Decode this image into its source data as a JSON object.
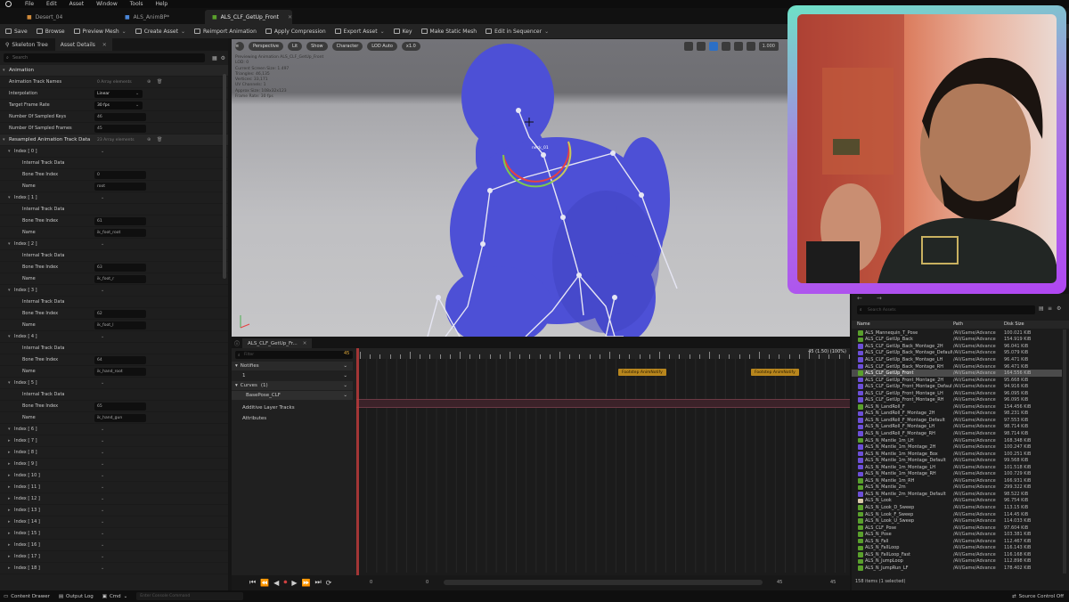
{
  "menu": [
    "File",
    "Edit",
    "Asset",
    "Window",
    "Tools",
    "Help"
  ],
  "doc_tabs": [
    {
      "label": "Desert_04",
      "active": false
    },
    {
      "label": "ALS_AnimBP*",
      "active": false
    },
    {
      "label": "ALS_CLF_GetUp_Front",
      "active": true
    }
  ],
  "toolbar": [
    {
      "label": "Save",
      "icon": "save-icon"
    },
    {
      "label": "Browse",
      "icon": "browse-icon"
    },
    {
      "label": "Preview Mesh",
      "icon": "preview-mesh-icon",
      "dropdown": true
    },
    {
      "label": "Create Asset",
      "icon": "create-asset-icon",
      "dropdown": true
    },
    {
      "label": "Reimport Animation",
      "icon": "reimport-icon"
    },
    {
      "label": "Apply Compression",
      "icon": "compression-icon"
    },
    {
      "label": "Export Asset",
      "icon": "export-icon",
      "dropdown": true
    },
    {
      "label": "Key",
      "icon": "key-icon"
    },
    {
      "label": "Make Static Mesh",
      "icon": "static-mesh-icon"
    },
    {
      "label": "Edit in Sequencer",
      "icon": "sequencer-icon",
      "dropdown": true
    }
  ],
  "left_panel": {
    "tabs": [
      "Skeleton Tree",
      "Asset Details"
    ],
    "search_placeholder": "Search",
    "rows": [
      {
        "type": "cat",
        "label": "Animation",
        "indent": 0
      },
      {
        "type": "prop",
        "label": "Animation Track Names",
        "indent": 1,
        "value": "0 Array elements",
        "style": "dim"
      },
      {
        "type": "prop",
        "label": "Interpolation",
        "indent": 1,
        "value": "Linear",
        "style": "dd"
      },
      {
        "type": "prop",
        "label": "Target Frame Rate",
        "indent": 1,
        "value": "30 fps",
        "style": "dd"
      },
      {
        "type": "prop",
        "label": "Number Of Sampled Keys",
        "indent": 1,
        "value": "46",
        "style": "box"
      },
      {
        "type": "prop",
        "label": "Number Of Sampled Frames",
        "indent": 1,
        "value": "45",
        "style": "box"
      },
      {
        "type": "cat",
        "label": "Resampled Animation Track Data",
        "indent": 0,
        "value": "23 Array elements",
        "style": "dim"
      },
      {
        "type": "idx",
        "label": "Index [ 0 ]",
        "indent": 1
      },
      {
        "type": "prop",
        "label": "Internal Track Data",
        "indent": 2
      },
      {
        "type": "prop",
        "label": "Bone Tree Index",
        "indent": 2,
        "value": "0",
        "style": "box"
      },
      {
        "type": "prop",
        "label": "Name",
        "indent": 2,
        "value": "root",
        "style": "box"
      },
      {
        "type": "idx",
        "label": "Index [ 1 ]",
        "indent": 1
      },
      {
        "type": "prop",
        "label": "Internal Track Data",
        "indent": 2
      },
      {
        "type": "prop",
        "label": "Bone Tree Index",
        "indent": 2,
        "value": "61",
        "style": "box"
      },
      {
        "type": "prop",
        "label": "Name",
        "indent": 2,
        "value": "ik_foot_root",
        "style": "box"
      },
      {
        "type": "idx",
        "label": "Index [ 2 ]",
        "indent": 1
      },
      {
        "type": "prop",
        "label": "Internal Track Data",
        "indent": 2
      },
      {
        "type": "prop",
        "label": "Bone Tree Index",
        "indent": 2,
        "value": "63",
        "style": "box"
      },
      {
        "type": "prop",
        "label": "Name",
        "indent": 2,
        "value": "ik_foot_r",
        "style": "box"
      },
      {
        "type": "idx",
        "label": "Index [ 3 ]",
        "indent": 1
      },
      {
        "type": "prop",
        "label": "Internal Track Data",
        "indent": 2
      },
      {
        "type": "prop",
        "label": "Bone Tree Index",
        "indent": 2,
        "value": "62",
        "style": "box"
      },
      {
        "type": "prop",
        "label": "Name",
        "indent": 2,
        "value": "ik_foot_l",
        "style": "box"
      },
      {
        "type": "idx",
        "label": "Index [ 4 ]",
        "indent": 1
      },
      {
        "type": "prop",
        "label": "Internal Track Data",
        "indent": 2
      },
      {
        "type": "prop",
        "label": "Bone Tree Index",
        "indent": 2,
        "value": "64",
        "style": "box"
      },
      {
        "type": "prop",
        "label": "Name",
        "indent": 2,
        "value": "ik_hand_root",
        "style": "box"
      },
      {
        "type": "idx",
        "label": "Index [ 5 ]",
        "indent": 1
      },
      {
        "type": "prop",
        "label": "Internal Track Data",
        "indent": 2
      },
      {
        "type": "prop",
        "label": "Bone Tree Index",
        "indent": 2,
        "value": "65",
        "style": "box"
      },
      {
        "type": "prop",
        "label": "Name",
        "indent": 2,
        "value": "ik_hand_gun",
        "style": "box"
      },
      {
        "type": "idx",
        "label": "Index [ 6 ]",
        "indent": 1
      },
      {
        "type": "idx",
        "label": "Index [ 7 ]",
        "indent": 1
      },
      {
        "type": "idx",
        "label": "Index [ 8 ]",
        "indent": 1
      },
      {
        "type": "idx",
        "label": "Index [ 9 ]",
        "indent": 1
      },
      {
        "type": "idx",
        "label": "Index [ 10 ]",
        "indent": 1
      },
      {
        "type": "idx",
        "label": "Index [ 11 ]",
        "indent": 1
      },
      {
        "type": "idx",
        "label": "Index [ 12 ]",
        "indent": 1
      },
      {
        "type": "idx",
        "label": "Index [ 13 ]",
        "indent": 1
      },
      {
        "type": "idx",
        "label": "Index [ 14 ]",
        "indent": 1
      },
      {
        "type": "idx",
        "label": "Index [ 15 ]",
        "indent": 1
      },
      {
        "type": "idx",
        "label": "Index [ 16 ]",
        "indent": 1
      },
      {
        "type": "idx",
        "label": "Index [ 17 ]",
        "indent": 1
      },
      {
        "type": "idx",
        "label": "Index [ 18 ]",
        "indent": 1
      }
    ]
  },
  "viewport": {
    "buttons": [
      "Perspective",
      "Lit",
      "Show",
      "Character",
      "LOD Auto",
      "x1.0"
    ],
    "fov": "1.000",
    "info_lines": [
      "Previewing Animation ALS_CLF_GetUp_Front",
      "LOD: 0",
      "Current Screen Size: 1.497",
      "Triangles: 46,135",
      "Vertices: 33,171",
      "UV Channels: 1",
      "Approx Size: 108x32x123",
      "Frame Rate: 30 fps"
    ],
    "bone_label": "neck_01"
  },
  "sequencer": {
    "tab": "ALS_CLF_GetUp_Fr...",
    "filter_placeholder": "Filter",
    "frame_counter": "45",
    "timecode": "45 (1.50) (100%)",
    "tracks": [
      {
        "label": "Notifies",
        "kind": "header"
      },
      {
        "label": "1",
        "kind": "sub"
      },
      {
        "label": "Curves",
        "count": "(1)",
        "kind": "header"
      },
      {
        "label": "BasePose_CLF",
        "kind": "curve"
      },
      {
        "label": "Additive Layer Tracks",
        "kind": "plain"
      },
      {
        "label": "Attributes",
        "kind": "plain"
      }
    ],
    "notifies": [
      "Footstep AnimNotify",
      "Footstep AnimNotify"
    ],
    "range_left": "0",
    "range_mid": "0",
    "range_right1": "45",
    "range_right2": "45"
  },
  "assets": {
    "search_placeholder": "Search Assets",
    "columns": [
      "Name",
      "Path",
      "Disk Size"
    ],
    "items": [
      {
        "name": "ALS_Mannequin_T_Pose",
        "path": "/All/Game/Advance",
        "size": "100.021 KiB",
        "color": "#5aa02c"
      },
      {
        "name": "ALS_CLF_GetUp_Back",
        "path": "/All/Game/Advance",
        "size": "154.919 KiB",
        "color": "#5aa02c"
      },
      {
        "name": "ALS_CLF_GetUp_Back_Montage_2H",
        "path": "/All/Game/Advance",
        "size": "96.041 KiB",
        "color": "#6c4fd8"
      },
      {
        "name": "ALS_CLF_GetUp_Back_Montage_Default",
        "path": "/All/Game/Advance",
        "size": "95.079 KiB",
        "color": "#6c4fd8"
      },
      {
        "name": "ALS_CLF_GetUp_Back_Montage_LH",
        "path": "/All/Game/Advance",
        "size": "96.471 KiB",
        "color": "#6c4fd8"
      },
      {
        "name": "ALS_CLF_GetUp_Back_Montage_RH",
        "path": "/All/Game/Advance",
        "size": "96.471 KiB",
        "color": "#6c4fd8"
      },
      {
        "name": "ALS_CLF_GetUp_Front",
        "path": "/All/Game/Advance",
        "size": "164.556 KiB",
        "color": "#5aa02c",
        "selected": true
      },
      {
        "name": "ALS_CLF_GetUp_Front_Montage_2H",
        "path": "/All/Game/Advance",
        "size": "95.668 KiB",
        "color": "#6c4fd8"
      },
      {
        "name": "ALS_CLF_GetUp_Front_Montage_Default",
        "path": "/All/Game/Advance",
        "size": "94.916 KiB",
        "color": "#6c4fd8"
      },
      {
        "name": "ALS_CLF_GetUp_Front_Montage_LH",
        "path": "/All/Game/Advance",
        "size": "96.095 KiB",
        "color": "#6c4fd8"
      },
      {
        "name": "ALS_CLF_GetUp_Front_Montage_RH",
        "path": "/All/Game/Advance",
        "size": "96.095 KiB",
        "color": "#6c4fd8"
      },
      {
        "name": "ALS_N_LandRoll_F",
        "path": "/All/Game/Advance",
        "size": "154.456 KiB",
        "color": "#5aa02c"
      },
      {
        "name": "ALS_N_LandRoll_F_Montage_2H",
        "path": "/All/Game/Advance",
        "size": "98.231 KiB",
        "color": "#6c4fd8"
      },
      {
        "name": "ALS_N_LandRoll_F_Montage_Default",
        "path": "/All/Game/Advance",
        "size": "97.553 KiB",
        "color": "#6c4fd8"
      },
      {
        "name": "ALS_N_LandRoll_F_Montage_LH",
        "path": "/All/Game/Advance",
        "size": "98.714 KiB",
        "color": "#6c4fd8"
      },
      {
        "name": "ALS_N_LandRoll_F_Montage_RH",
        "path": "/All/Game/Advance",
        "size": "98.714 KiB",
        "color": "#6c4fd8"
      },
      {
        "name": "ALS_N_Mantle_1m_LH",
        "path": "/All/Game/Advance",
        "size": "168.348 KiB",
        "color": "#5aa02c"
      },
      {
        "name": "ALS_N_Mantle_1m_Montage_2H",
        "path": "/All/Game/Advance",
        "size": "100.247 KiB",
        "color": "#6c4fd8"
      },
      {
        "name": "ALS_N_Mantle_1m_Montage_Box",
        "path": "/All/Game/Advance",
        "size": "100.251 KiB",
        "color": "#6c4fd8"
      },
      {
        "name": "ALS_N_Mantle_1m_Montage_Default",
        "path": "/All/Game/Advance",
        "size": "99.568 KiB",
        "color": "#6c4fd8"
      },
      {
        "name": "ALS_N_Mantle_1m_Montage_LH",
        "path": "/All/Game/Advance",
        "size": "101.518 KiB",
        "color": "#6c4fd8"
      },
      {
        "name": "ALS_N_Mantle_1m_Montage_RH",
        "path": "/All/Game/Advance",
        "size": "100.729 KiB",
        "color": "#6c4fd8"
      },
      {
        "name": "ALS_N_Mantle_1m_RH",
        "path": "/All/Game/Advance",
        "size": "166.931 KiB",
        "color": "#5aa02c"
      },
      {
        "name": "ALS_N_Mantle_2m",
        "path": "/All/Game/Advance",
        "size": "299.322 KiB",
        "color": "#5aa02c"
      },
      {
        "name": "ALS_N_Mantle_2m_Montage_Default",
        "path": "/All/Game/Advance",
        "size": "98.522 KiB",
        "color": "#6c4fd8"
      },
      {
        "name": "ALS_N_Look",
        "path": "/All/Game/Advance",
        "size": "96.754 KiB",
        "color": "#d9c9a8"
      },
      {
        "name": "ALS_N_Look_D_Sweep",
        "path": "/All/Game/Advance",
        "size": "113.15 KiB",
        "color": "#5aa02c"
      },
      {
        "name": "ALS_N_Look_F_Sweep",
        "path": "/All/Game/Advance",
        "size": "114.45 KiB",
        "color": "#5aa02c"
      },
      {
        "name": "ALS_N_Look_U_Sweep",
        "path": "/All/Game/Advance",
        "size": "114.033 KiB",
        "color": "#5aa02c"
      },
      {
        "name": "ALS_CLF_Pose",
        "path": "/All/Game/Advance",
        "size": "97.604 KiB",
        "color": "#5aa02c"
      },
      {
        "name": "ALS_N_Pose",
        "path": "/All/Game/Advance",
        "size": "103.381 KiB",
        "color": "#5aa02c"
      },
      {
        "name": "ALS_N_Fall",
        "path": "/All/Game/Advance",
        "size": "112.467 KiB",
        "color": "#5aa02c"
      },
      {
        "name": "ALS_N_FallLoop",
        "path": "/All/Game/Advance",
        "size": "116.143 KiB",
        "color": "#5aa02c"
      },
      {
        "name": "ALS_N_FallLoop_Fast",
        "path": "/All/Game/Advance",
        "size": "116.168 KiB",
        "color": "#5aa02c"
      },
      {
        "name": "ALS_N_JumpLoop",
        "path": "/All/Game/Advance",
        "size": "112.898 KiB",
        "color": "#5aa02c"
      },
      {
        "name": "ALS_N_JumpRun_LF",
        "path": "/All/Game/Advance",
        "size": "178.402 KiB",
        "color": "#5aa02c"
      }
    ],
    "footer": "158 items (1 selected)"
  },
  "statusbar": {
    "content_drawer": "Content Drawer",
    "output_log": "Output Log",
    "cmd": "Cmd",
    "cmd_placeholder": "Enter Console Command",
    "source_control": "Source Control Off"
  },
  "colors": {
    "accent_blue": "#2b6fc6",
    "webcam_border_top": "#6ee1c7",
    "webcam_border_bottom": "#b046f2",
    "mannequin": "#4c4fd6",
    "notify": "#b8861d"
  }
}
